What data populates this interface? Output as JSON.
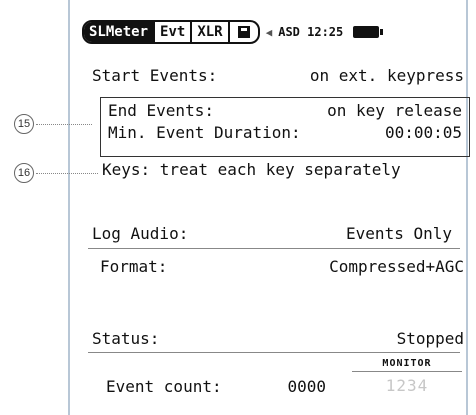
{
  "header": {
    "tabs": [
      {
        "label": "SLMeter"
      },
      {
        "label": "Evt"
      },
      {
        "label": "XLR"
      }
    ],
    "icons": {
      "save": "save-icon",
      "speaker": "speaker-icon",
      "battery": "battery-icon"
    },
    "status_text": "ASD 12:25"
  },
  "callouts": [
    "15",
    "16"
  ],
  "settings": {
    "start_events": {
      "label": "Start Events:",
      "value": "on ext. keypress"
    },
    "end_events": {
      "label": "End  Events:",
      "value": "on key release"
    },
    "min_event_duration": {
      "label": "Min. Event Duration:",
      "value": "00:00:05"
    },
    "keys": {
      "label": "Keys: treat each key separately"
    },
    "log_audio": {
      "label": "Log Audio:",
      "value": "Events Only"
    },
    "format": {
      "label": "Format:",
      "value": "Compressed+AGC"
    },
    "status": {
      "label": "Status:",
      "value": "Stopped"
    },
    "event_count": {
      "label": "Event count:",
      "value": "0000"
    }
  },
  "monitor": {
    "label": "MONITOR",
    "digits": "1234"
  }
}
